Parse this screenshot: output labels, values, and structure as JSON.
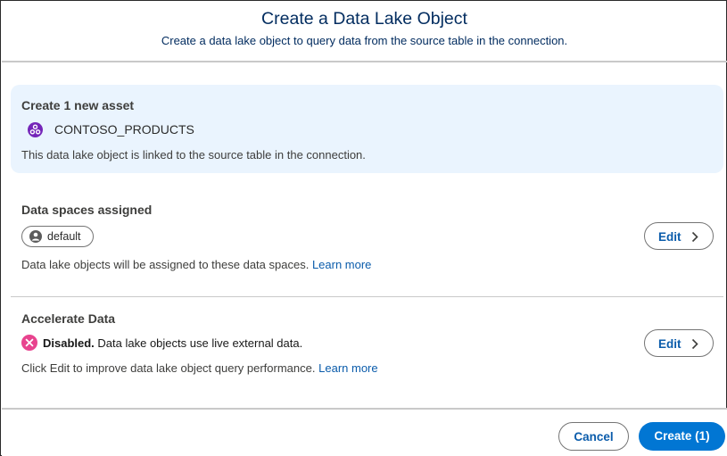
{
  "header": {
    "title": "Create a Data Lake Object",
    "subtitle": "Create a data lake object to query data from the source table in the connection."
  },
  "asset": {
    "heading": "Create 1 new asset",
    "icon": "data-lake-object-icon",
    "name": "CONTOSO_PRODUCTS",
    "description": "This data lake object is linked to the source table in the connection."
  },
  "data_spaces": {
    "heading": "Data spaces assigned",
    "pill_icon": "data-space-icon",
    "pill_label": "default",
    "description": "Data lake objects will be assigned to these data spaces.",
    "learn_more": "Learn more",
    "edit_label": "Edit"
  },
  "accelerate": {
    "heading": "Accelerate Data",
    "status_icon": "disabled-icon",
    "status_label": "Disabled.",
    "status_text": "Data lake objects use live external data.",
    "description": "Click Edit to improve data lake object query performance.",
    "learn_more": "Learn more",
    "edit_label": "Edit"
  },
  "footer": {
    "cancel_label": "Cancel",
    "create_label": "Create (1)"
  },
  "colors": {
    "brand_blue": "#0176d3",
    "link_blue": "#0b5cab",
    "title_navy": "#032d60",
    "asset_panel": "#eaf4fe",
    "asset_icon": "#7526b9",
    "disabled_pink": "#e8438e"
  }
}
